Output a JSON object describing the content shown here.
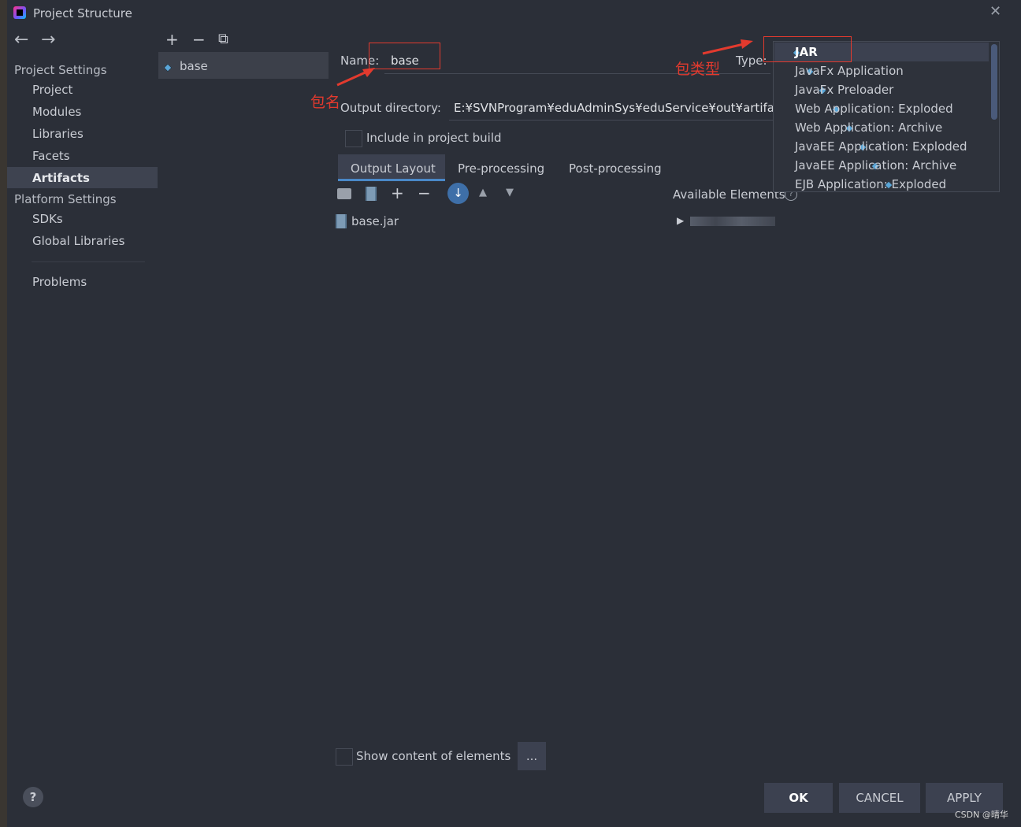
{
  "window": {
    "title": "Project Structure",
    "close_glyph": "✕"
  },
  "nav": {
    "back": "←",
    "forward": "→"
  },
  "sidebar": {
    "group1": "Project Settings",
    "items1": [
      "Project",
      "Modules",
      "Libraries",
      "Facets",
      "Artifacts"
    ],
    "group2": "Platform Settings",
    "items2": [
      "SDKs",
      "Global Libraries"
    ],
    "problems": "Problems",
    "selected": "Artifacts"
  },
  "artifact_list": {
    "toolbar": {
      "add": "+",
      "remove": "−",
      "copy": "⧉"
    },
    "items": [
      "base"
    ]
  },
  "form": {
    "name_label": "Name:",
    "name_value": "base",
    "type_label": "Type:",
    "output_label": "Output directory:",
    "output_value": "E:¥SVNProgram¥eduAdminSys¥eduService¥out¥artifact",
    "include_label": "Include in project build",
    "include_checked": false
  },
  "tabs": [
    "Output Layout",
    "Pre-processing",
    "Post-processing"
  ],
  "active_tab": "Output Layout",
  "layout_toolbar": {
    "add": "+",
    "remove": "−",
    "up": "▲",
    "down": "▼",
    "sort": "↓"
  },
  "layout_tree": [
    "base.jar"
  ],
  "available": {
    "label": "Available Elements",
    "help": "?",
    "expand": "▶"
  },
  "type_dropdown": {
    "items": [
      "JAR",
      "JavaFx Application",
      "JavaFx Preloader",
      "Web Application: Exploded",
      "Web Application: Archive",
      "JavaEE Application: Exploded",
      "JavaEE Application: Archive",
      "EJB Application: Exploded"
    ],
    "selected": "JAR"
  },
  "bottom": {
    "show_content_label": "Show content of elements",
    "ellipsis": "...",
    "help": "?",
    "ok": "OK",
    "cancel": "CANCEL",
    "apply": "APPLY"
  },
  "annotations": {
    "name_note": "包名",
    "type_note": "包类型"
  },
  "watermark": "CSDN @晴华",
  "colors": {
    "accent": "#4a88c7",
    "annotation": "#e23a2e",
    "background": "#2b2f38"
  }
}
